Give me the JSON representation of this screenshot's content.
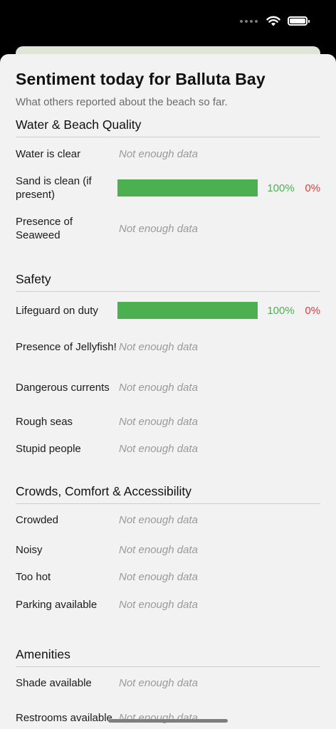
{
  "header": {
    "title": "Sentiment today for Balluta Bay",
    "subtitle": "What others reported about the beach so far."
  },
  "colors": {
    "positive": "#4caf50",
    "negative": "#e53935",
    "empty": "#9a9a9a"
  },
  "sections": {
    "water": {
      "title": "Water & Beach Quality",
      "items": [
        {
          "label": "Water is clear",
          "value": "Not enough data"
        },
        {
          "label": "Sand is clean (if present)",
          "positive_pct": 100,
          "pos_text": "100%",
          "neg_text": "0%"
        },
        {
          "label": "Presence of Seaweed",
          "value": "Not enough data"
        }
      ]
    },
    "safety": {
      "title": "Safety",
      "items": [
        {
          "label": "Lifeguard on duty",
          "positive_pct": 100,
          "pos_text": "100%",
          "neg_text": "0%"
        },
        {
          "label": "Presence of Jellyfish!",
          "value": "Not enough data"
        },
        {
          "label": "Dangerous currents",
          "value": "Not enough data"
        },
        {
          "label": "Rough seas",
          "value": "Not enough data"
        },
        {
          "label": "Stupid people",
          "value": "Not enough data"
        }
      ]
    },
    "crowds": {
      "title": "Crowds, Comfort & Accessibility",
      "items": [
        {
          "label": "Crowded",
          "value": "Not enough data"
        },
        {
          "label": "Noisy",
          "value": "Not enough data"
        },
        {
          "label": "Too hot",
          "value": "Not enough data"
        },
        {
          "label": "Parking available",
          "value": "Not enough data"
        }
      ]
    },
    "amenities": {
      "title": "Amenities",
      "items": [
        {
          "label": "Shade available",
          "value": "Not enough data"
        },
        {
          "label": "Restrooms available",
          "value": "Not enough data"
        }
      ]
    }
  }
}
